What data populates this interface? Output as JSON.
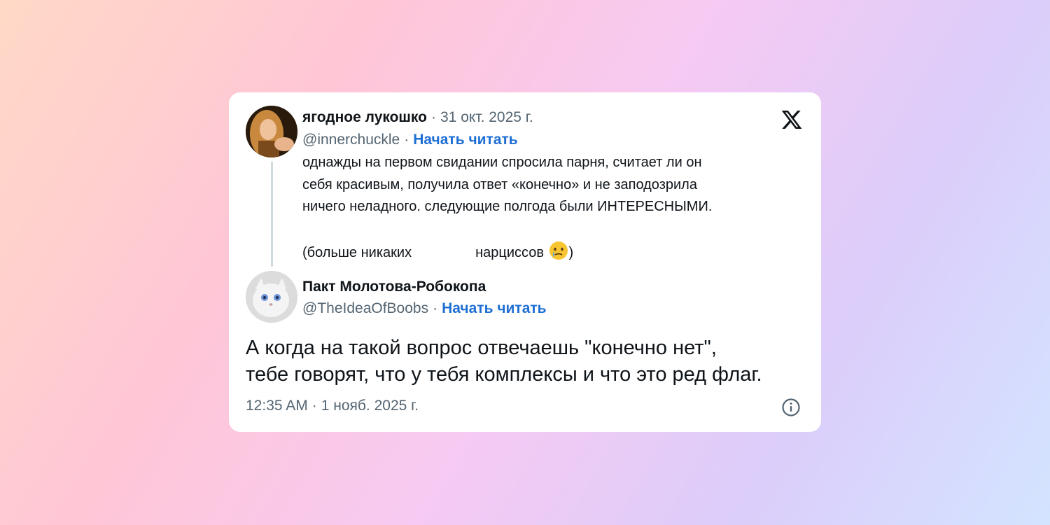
{
  "quoted_tweet": {
    "author_name": "ягодное лукошко",
    "date": "31 окт. 2025 г.",
    "handle": "@innerchuckle",
    "follow_label": "Начать читать",
    "text_lines": [
      "однажды на первом свидании спросила парня, считает ли он",
      "себя красивым, получила ответ «конечно» и не заподозрила",
      "ничего неладного. следующие полгода были ИНТЕРЕСНЫМИ."
    ],
    "closing_left": "(больше никаких",
    "closing_right": "нарциссов",
    "closing_end": ")",
    "emoji": "crying-face-icon"
  },
  "reply_tweet": {
    "author_name": "Пакт Молотова-Робокопа",
    "handle": "@TheIdeaOfBoobs",
    "follow_label": "Начать читать",
    "text_lines": [
      "А когда на такой вопрос отвечаешь \"конечно нет\",",
      "тебе говорят, что у тебя комплексы и что это ред флаг."
    ],
    "time": "12:35 AM",
    "date": "1 нояб. 2025 г."
  },
  "separator": "·",
  "icons": [
    "x-logo-icon",
    "info-icon",
    "thread-line"
  ],
  "colors": {
    "link": "#1d6ed4",
    "muted": "#536471",
    "text": "#0f1419"
  }
}
